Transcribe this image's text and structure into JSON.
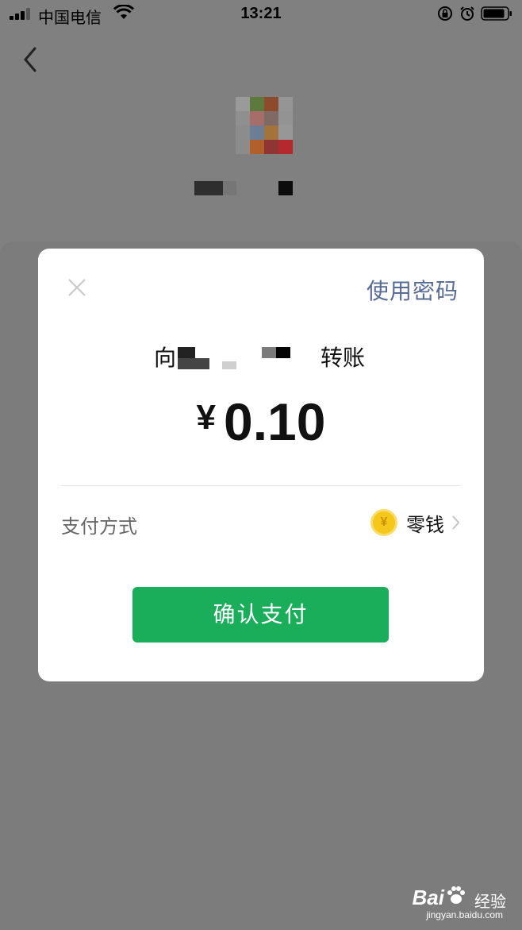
{
  "status_bar": {
    "carrier": "中国电信",
    "time": "13:21"
  },
  "dialog": {
    "use_password": "使用密码",
    "to_prefix": "向",
    "transfer_suffix": "转账",
    "currency_symbol": "¥",
    "amount": "0.10",
    "pay_method_label": "支付方式",
    "pay_method_value": "零钱",
    "confirm_label": "确认支付"
  },
  "watermark": {
    "brand": "Bai",
    "jingyan": "经验",
    "url": "jingyan.baidu.com"
  },
  "colors": {
    "accent_green": "#1aad5a",
    "link_blue": "#576b95",
    "coin_gold": "#f5c71a",
    "overlay_gray": "#808080"
  },
  "icons": [
    "signal-icon",
    "wifi-icon",
    "rotation-lock-icon",
    "alarm-icon",
    "battery-icon",
    "back-chevron-icon",
    "close-icon",
    "coin-icon",
    "chevron-right-icon",
    "baidu-paw-icon"
  ]
}
